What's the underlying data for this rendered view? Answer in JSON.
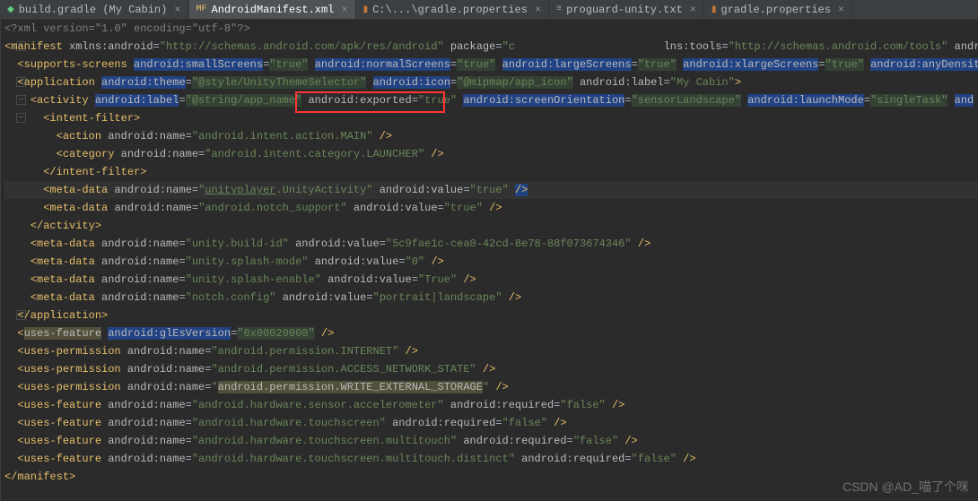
{
  "tabs": [
    {
      "icon": "gradle",
      "label": "build.gradle (My Cabin)",
      "active": false
    },
    {
      "icon": "xml",
      "label": "AndroidManifest.xml",
      "active": true
    },
    {
      "icon": "props",
      "label": "C:\\...\\gradle.properties",
      "active": false
    },
    {
      "icon": "txt",
      "label": "proguard-unity.txt",
      "active": false
    },
    {
      "icon": "props",
      "label": "gradle.properties",
      "active": false
    }
  ],
  "close_glyph": "×",
  "watermark": "CSDN @AD_喵了个咪",
  "highlighted_box": {
    "attr": "android:exported",
    "value": "\"true\""
  },
  "code": {
    "l1": {
      "decl": "<?xml version=\"1.0\" encoding=\"utf-8\"?>"
    },
    "l2": {
      "tag": "manifest",
      "a1n": "xmlns:android",
      "a1v": "\"http://schemas.android.com/apk/res/android\"",
      "a2n": "package",
      "a2v": "\"c",
      "a3n": "lns:tools",
      "a3v": "\"http://schemas.android.com/tools\"",
      "a4n": "androi"
    },
    "l3": {
      "tag": "supports-screens",
      "a1n": "android:smallScreens",
      "a1v": "\"true\"",
      "a2n": "android:normalScreens",
      "a2v": "\"true\"",
      "a3n": "android:largeScreens",
      "a3v": "\"true\"",
      "a4n": "android:xlargeScreens",
      "a4v": "\"true\"",
      "a5n": "android:anyDensit"
    },
    "l4": {
      "tag": "application",
      "a1n": "android:theme",
      "a1v": "\"@style/UnityThemeSelector\"",
      "a2n": "android:icon",
      "a2v": "\"@mipmap/app_icon\"",
      "a3n": "android:label",
      "a3v": "\"My Cabin\""
    },
    "l5": {
      "tag": "activity",
      "a1n": "android:label",
      "a1v": "\"@string/app_name\"",
      "a2n": "android:exported",
      "a2v": "\"true\"",
      "a3n": "android:screenOrientation",
      "a3v": "\"sensorLandscape\"",
      "a4n": "android:launchMode",
      "a4v": "\"singleTask\"",
      "a5n": "and"
    },
    "l6": {
      "tag": "intent-filter"
    },
    "l7": {
      "tag": "action",
      "a1n": "android:name",
      "a1v": "\"android.intent.action.MAIN\""
    },
    "l8": {
      "tag": "category",
      "a1n": "android:name",
      "a1v": "\"android.intent.category.LAUNCHER\""
    },
    "l9": {
      "tag": "/intent-filter"
    },
    "l10": {
      "tag": "meta-data",
      "a1n": "android:name",
      "a1v_a": "\"",
      "a1v_b": "unityplayer",
      "a1v_c": ".UnityActivity\"",
      "a2n": "android:value",
      "a2v": "\"true\"",
      "end": "/>"
    },
    "l11": {
      "tag": "meta-data",
      "a1n": "android:name",
      "a1v": "\"android.notch_support\"",
      "a2n": "android:value",
      "a2v": "\"true\""
    },
    "l12": {
      "tag": "/activity"
    },
    "l13": {
      "tag": "meta-data",
      "a1n": "android:name",
      "a1v": "\"unity.build-id\"",
      "a2n": "android:value",
      "a2v": "\"5c9fae1c-cea0-42cd-8e78-88f073674346\""
    },
    "l14": {
      "tag": "meta-data",
      "a1n": "android:name",
      "a1v": "\"unity.splash-mode\"",
      "a2n": "android:value",
      "a2v": "\"0\""
    },
    "l15": {
      "tag": "meta-data",
      "a1n": "android:name",
      "a1v": "\"unity.splash-enable\"",
      "a2n": "android:value",
      "a2v": "\"True\""
    },
    "l16": {
      "tag": "meta-data",
      "a1n": "android:name",
      "a1v": "\"notch.config\"",
      "a2n": "android:value",
      "a2v": "\"portrait|landscape\""
    },
    "l17": {
      "tag": "/application"
    },
    "l18": {
      "tag": "uses-feature",
      "a1n": "android:glEsVersion",
      "a1v": "\"0x00020000\""
    },
    "l19": {
      "tag": "uses-permission",
      "a1n": "android:name",
      "a1v": "\"android.permission.INTERNET\""
    },
    "l20": {
      "tag": "uses-permission",
      "a1n": "android:name",
      "a1v": "\"android.permission.ACCESS_NETWORK_STATE\""
    },
    "l21": {
      "tag": "uses-permission",
      "a1n": "android:name",
      "a1v": "\"",
      "a1v2": "android.permission.WRITE_EXTERNAL_STORAGE",
      "a1v3": "\""
    },
    "l22": {
      "tag": "uses-feature",
      "a1n": "android:name",
      "a1v": "\"android.hardware.sensor.accelerometer\"",
      "a2n": "android:required",
      "a2v": "\"false\""
    },
    "l23": {
      "tag": "uses-feature",
      "a1n": "android:name",
      "a1v": "\"android.hardware.touchscreen\"",
      "a2n": "android:required",
      "a2v": "\"false\""
    },
    "l24": {
      "tag": "uses-feature",
      "a1n": "android:name",
      "a1v": "\"android.hardware.touchscreen.multitouch\"",
      "a2n": "android:required",
      "a2v": "\"false\""
    },
    "l25": {
      "tag": "uses-feature",
      "a1n": "android:name",
      "a1v": "\"android.hardware.touchscreen.multitouch.distinct\"",
      "a2n": "android:required",
      "a2v": "\"false\""
    },
    "l26": {
      "tag": "/manifest"
    }
  }
}
